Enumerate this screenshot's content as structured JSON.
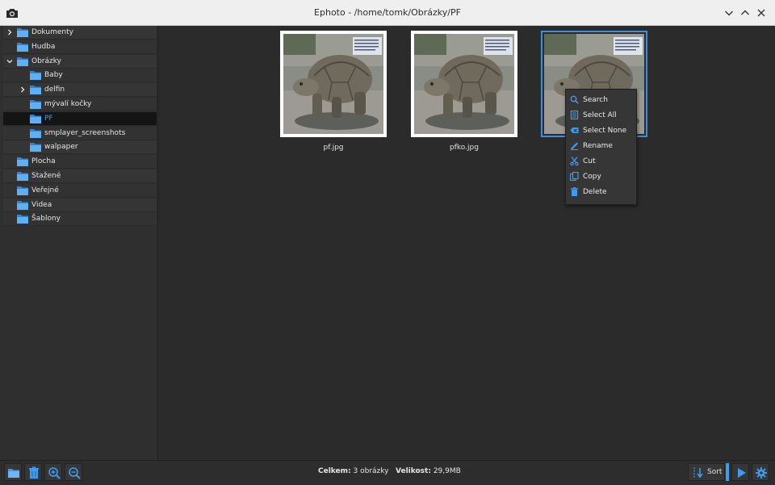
{
  "window": {
    "title": "Ephoto - /home/tomk/Obrázky/PF"
  },
  "sidebar": {
    "items": [
      {
        "label": "Dokumenty",
        "level": 0,
        "expander": "collapsed",
        "selected": false
      },
      {
        "label": "Hudba",
        "level": 0,
        "expander": "none",
        "selected": false
      },
      {
        "label": "Obrázky",
        "level": 0,
        "expander": "expanded",
        "selected": false
      },
      {
        "label": "Baby",
        "level": 1,
        "expander": "none",
        "selected": false
      },
      {
        "label": "delfin",
        "level": 1,
        "expander": "collapsed",
        "selected": false
      },
      {
        "label": "mývalí kočky",
        "level": 1,
        "expander": "none",
        "selected": false
      },
      {
        "label": "PF",
        "level": 1,
        "expander": "none",
        "selected": true
      },
      {
        "label": "smplayer_screenshots",
        "level": 1,
        "expander": "none",
        "selected": false
      },
      {
        "label": "walpaper",
        "level": 1,
        "expander": "none",
        "selected": false
      },
      {
        "label": "Plocha",
        "level": 0,
        "expander": "none",
        "selected": false
      },
      {
        "label": "Stažené",
        "level": 0,
        "expander": "none",
        "selected": false
      },
      {
        "label": "Veřejné",
        "level": 0,
        "expander": "none",
        "selected": false
      },
      {
        "label": "Videa",
        "level": 0,
        "expander": "none",
        "selected": false
      },
      {
        "label": "Šablony",
        "level": 0,
        "expander": "none",
        "selected": false
      }
    ]
  },
  "thumbnails": [
    {
      "caption": "pf.jpg",
      "selected": false
    },
    {
      "caption": "pfko.jpg",
      "selected": false
    },
    {
      "caption": "",
      "selected": true
    }
  ],
  "context_menu": {
    "items": [
      {
        "label": "Search",
        "icon": "search-icon"
      },
      {
        "label": "Select All",
        "icon": "select-all-icon"
      },
      {
        "label": "Select None",
        "icon": "select-none-icon"
      },
      {
        "label": "Rename",
        "icon": "rename-icon"
      },
      {
        "label": "Cut",
        "icon": "cut-icon"
      },
      {
        "label": "Copy",
        "icon": "copy-icon"
      },
      {
        "label": "Delete",
        "icon": "delete-icon"
      }
    ]
  },
  "status": {
    "total_label": "Celkem:",
    "total_value": "3 obrázky",
    "size_label": "Velikost:",
    "size_value": "29,9MB"
  },
  "toolbar": {
    "left_buttons": [
      "open-folder-icon",
      "delete-icon",
      "zoom-in-icon",
      "zoom-out-icon"
    ],
    "sort_label": "Sort",
    "right_buttons": [
      "slideshow-play-icon",
      "settings-gear-icon"
    ]
  },
  "colors": {
    "accent": "#3d9cf0",
    "background": "#2b2b2b",
    "titlebar": "#efefef"
  }
}
